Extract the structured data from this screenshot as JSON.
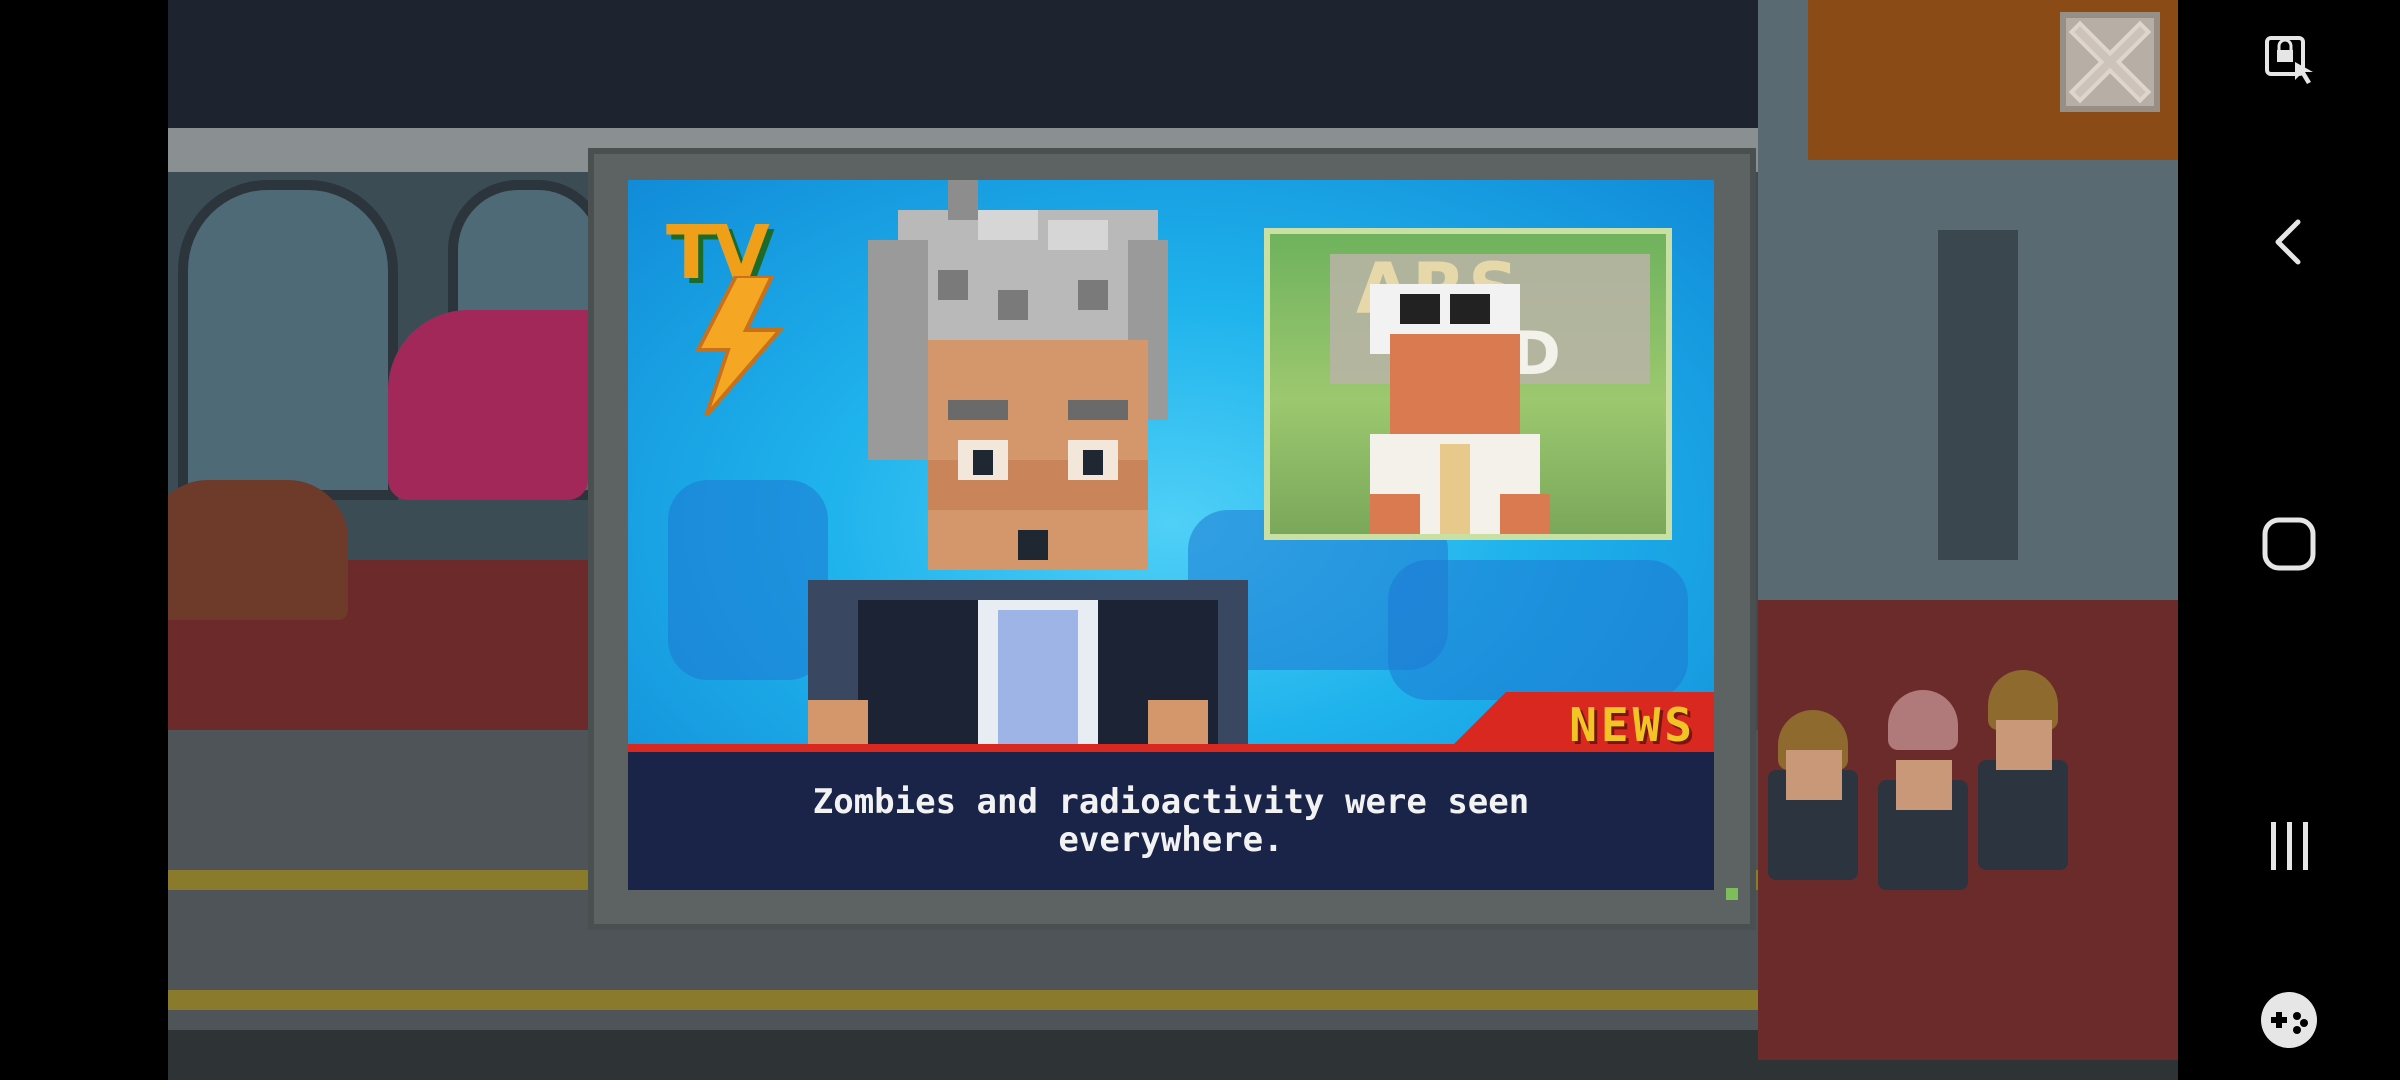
{
  "window": {
    "close_label": "Close"
  },
  "tv": {
    "logo_text": "TV",
    "inset_sign_text": "ARS",
    "inset_sign_text_2": "ED",
    "banner_label": "NEWS",
    "caption": "Zombies and radioactivity were seen\neverywhere."
  },
  "system_nav": {
    "items": [
      {
        "icon": "screen-touch-lock-icon",
        "label": "Touch lock"
      },
      {
        "icon": "back-icon",
        "label": "Back"
      },
      {
        "icon": "home-icon",
        "label": "Home"
      },
      {
        "icon": "recents-icon",
        "label": "Recent apps"
      },
      {
        "icon": "game-tools-icon",
        "label": "Game tools"
      }
    ]
  },
  "colors": {
    "screen_blue": "#1fb3ec",
    "banner_red": "#d9281f",
    "banner_text": "#f3c425",
    "caption_bg": "#1a2448",
    "caption_text": "#f2f2f2",
    "tv_frame": "#5d6263"
  }
}
